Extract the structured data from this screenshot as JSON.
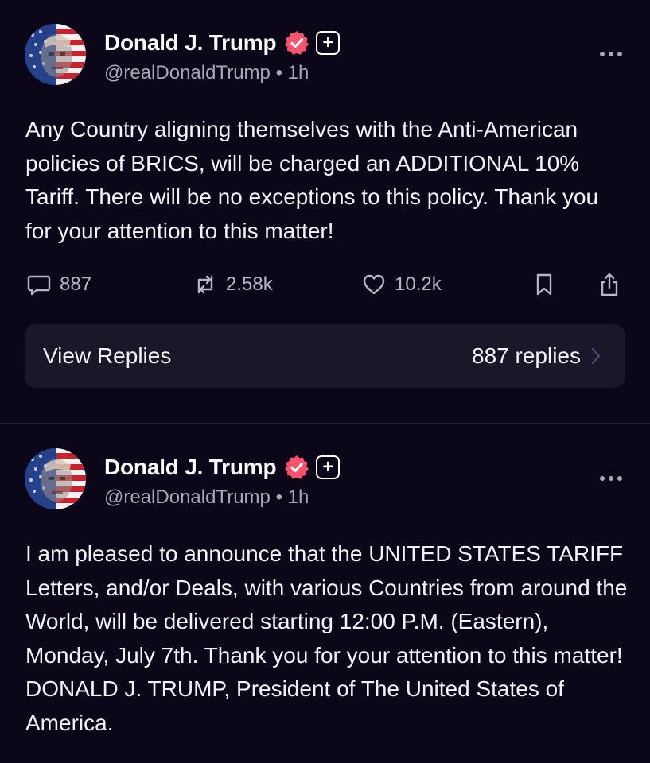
{
  "posts": [
    {
      "author_name": "Donald J. Trump",
      "handle": "@realDonaldTrump",
      "separator": "•",
      "time": "1h",
      "plus_label": "+",
      "text": "Any Country aligning themselves with the Anti-American policies of BRICS, will be charged an ADDITIONAL 10% Tariff. There will be no exceptions to this policy. Thank you for your attention to this matter!",
      "replies_count": "887",
      "retruths_count": "2.58k",
      "likes_count": "10.2k",
      "view_replies_label": "View Replies",
      "view_replies_count": "887 replies"
    },
    {
      "author_name": "Donald J. Trump",
      "handle": "@realDonaldTrump",
      "separator": "•",
      "time": "1h",
      "plus_label": "+",
      "text": "I am pleased to announce that the UNITED STATES TARIFF Letters, and/or Deals, with various Countries from around the World, will be delivered starting 12:00 P.M. (Eastern), Monday, July 7th. Thank you for your attention to this matter! DONALD J. TRUMP, President of The United States of America."
    }
  ],
  "icons": {
    "verified": "verified-badge-icon",
    "plus": "plus-badge-icon",
    "more": "more-icon",
    "reply": "reply-icon",
    "retruth": "retruth-icon",
    "like": "heart-icon",
    "bookmark": "bookmark-icon",
    "share": "share-icon",
    "chevron": "chevron-right-icon"
  },
  "colors": {
    "background": "#0b0719",
    "card": "#1a1728",
    "verified": "#f5546e",
    "muted": "#a9a6b8",
    "chevron": "#4a4671"
  }
}
